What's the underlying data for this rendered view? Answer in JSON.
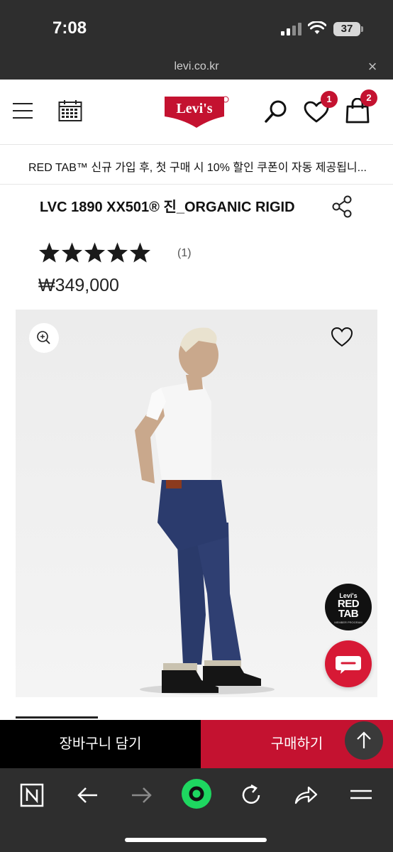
{
  "status_bar": {
    "time": "7:08",
    "battery": "37"
  },
  "browser": {
    "url": "levi.co.kr",
    "close_symbol": "×"
  },
  "header": {
    "logo_text": "Levi's",
    "wishlist_count": "1",
    "cart_count": "2"
  },
  "promo": {
    "text": "RED TAB™ 신규 가입 후, 첫 구매 시 10% 할인 쿠폰이 자동 제공됩니..."
  },
  "product": {
    "title": "LVC 1890 XX501® 진_ORGANIC RIGID",
    "rating": 5,
    "review_count": "(1)",
    "price": "₩349,000"
  },
  "badges": {
    "redtab_line1": "Levi's",
    "redtab_line2": "RED",
    "redtab_line3": "TAB",
    "redtab_line4": "MEMBER PROGRAM"
  },
  "actions": {
    "add_to_cart": "장바구니 담기",
    "buy_now": "구매하기"
  },
  "colors": {
    "brand_red": "#c41230",
    "dark_bar": "#2e2e2e",
    "browser_accent": "#1ed760"
  },
  "icons": [
    "hamburger-icon",
    "calendar-icon",
    "search-icon",
    "heart-icon",
    "bag-icon",
    "share-icon",
    "zoom-icon",
    "chat-icon",
    "arrow-up-icon",
    "n-tabs-icon",
    "back-arrow-icon",
    "forward-arrow-icon",
    "green-circle-icon",
    "refresh-icon",
    "share-forward-icon",
    "menu-icon"
  ]
}
